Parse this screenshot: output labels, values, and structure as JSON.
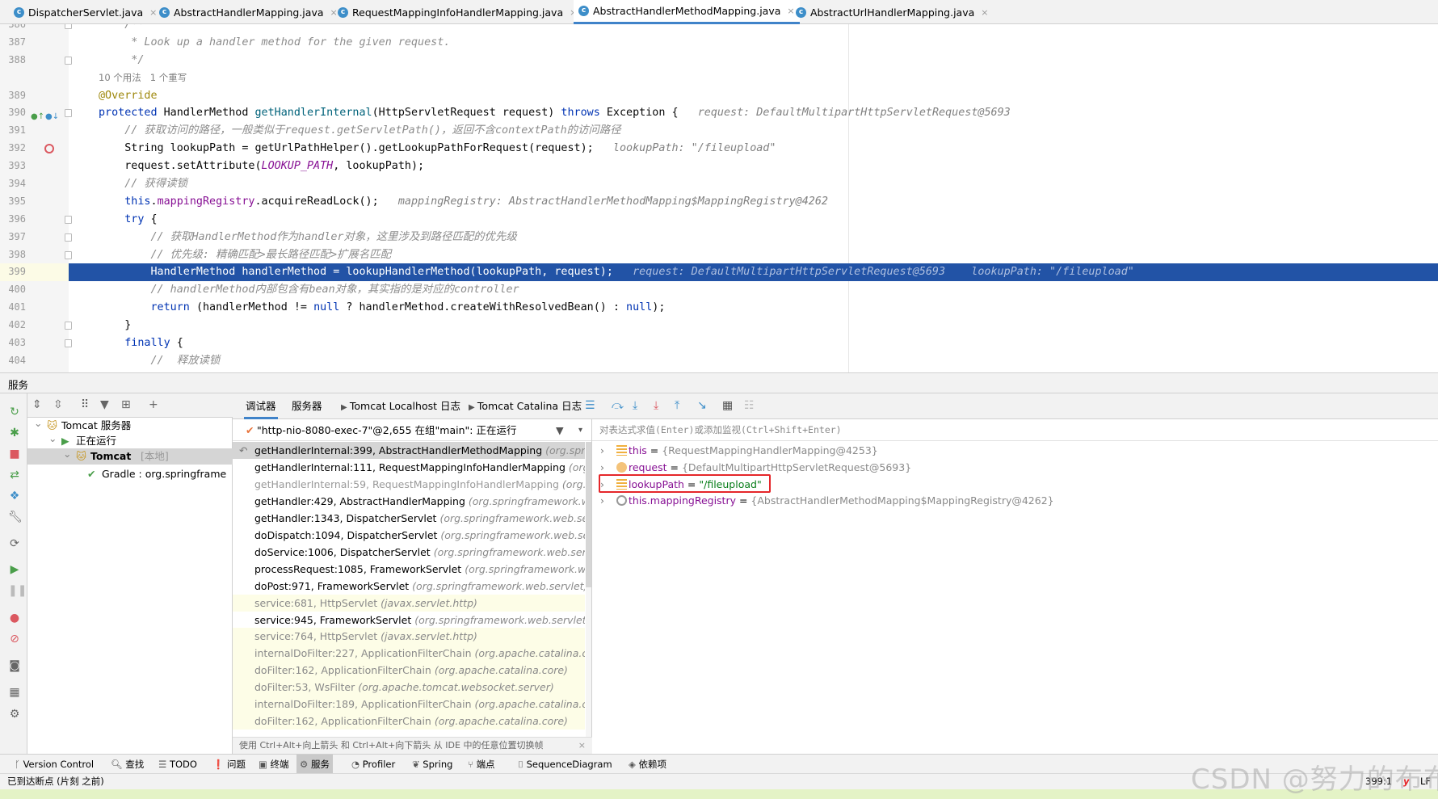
{
  "tabs": [
    {
      "label": "DispatcherServlet.java",
      "active": false
    },
    {
      "label": "AbstractHandlerMapping.java",
      "active": false
    },
    {
      "label": "RequestMappingInfoHandlerMapping.java",
      "active": false
    },
    {
      "label": "AbstractHandlerMethodMapping.java",
      "active": true
    },
    {
      "label": "AbstractUrlHandlerMapping.java",
      "active": false
    }
  ],
  "editor": {
    "current_line": 399,
    "lines": [
      {
        "n": "386",
        "fold": true,
        "tokens": [
          {
            "t": "    /**",
            "c": "cm"
          }
        ]
      },
      {
        "n": "387",
        "tokens": [
          {
            "t": "     * Look up a handler method for the given request.",
            "c": "cm"
          }
        ]
      },
      {
        "n": "388",
        "fold": true,
        "tokens": [
          {
            "t": "     */",
            "c": "cm"
          }
        ]
      },
      {
        "n": "",
        "inlay": "10 个用法   1 个重写"
      },
      {
        "n": "389",
        "tokens": [
          {
            "t": "@Override",
            "c": "ann"
          }
        ]
      },
      {
        "n": "390",
        "fold": true,
        "markers": true,
        "tokens": [
          {
            "t": "protected ",
            "c": "kw"
          },
          {
            "t": "HandlerMethod ",
            "c": "tx"
          },
          {
            "t": "getHandlerInternal",
            "c": "fn"
          },
          {
            "t": "(HttpServletRequest request) ",
            "c": "tx"
          },
          {
            "t": "throws ",
            "c": "kw"
          },
          {
            "t": "Exception {  ",
            "c": "tx"
          },
          {
            "t": " request: DefaultMultipartHttpServletRequest@5693",
            "c": "hint"
          }
        ]
      },
      {
        "n": "391",
        "tokens": [
          {
            "t": "    // 获取访问的路径，一般类似于request.getServletPath()，返回不含contextPath的访问路径",
            "c": "cm"
          }
        ]
      },
      {
        "n": "392",
        "breakpoint": true,
        "tokens": [
          {
            "t": "    String lookupPath = getUrlPathHelper().getLookupPathForRequest(request);  ",
            "c": "tx"
          },
          {
            "t": " lookupPath: \"/fileupload\"",
            "c": "hint"
          }
        ]
      },
      {
        "n": "393",
        "tokens": [
          {
            "t": "    request.setAttribute(",
            "c": "tx"
          },
          {
            "t": "LOOKUP_PATH",
            "c": "cst"
          },
          {
            "t": ", lookupPath);",
            "c": "tx"
          }
        ]
      },
      {
        "n": "394",
        "tokens": [
          {
            "t": "    // 获得读锁",
            "c": "cm"
          }
        ]
      },
      {
        "n": "395",
        "tokens": [
          {
            "t": "    this",
            "c": "kw"
          },
          {
            "t": ".",
            "c": "tx"
          },
          {
            "t": "mappingRegistry",
            "c": "fld"
          },
          {
            "t": ".acquireReadLock();  ",
            "c": "tx"
          },
          {
            "t": " mappingRegistry: AbstractHandlerMethodMapping$MappingRegistry@4262",
            "c": "hint"
          }
        ]
      },
      {
        "n": "396",
        "fold": true,
        "tokens": [
          {
            "t": "    try",
            "c": "kw"
          },
          {
            "t": " {",
            "c": "tx"
          }
        ]
      },
      {
        "n": "397",
        "fold": true,
        "tokens": [
          {
            "t": "        // 获取HandlerMethod作为handler对象，这里涉及到路径匹配的优先级",
            "c": "cm"
          }
        ]
      },
      {
        "n": "398",
        "fold": true,
        "tokens": [
          {
            "t": "        // 优先级: 精确匹配>最长路径匹配>扩展名匹配",
            "c": "cm"
          }
        ]
      },
      {
        "n": "399",
        "highlight": true,
        "tokens": [
          {
            "t": "        HandlerMethod handlerMethod = lookupHandlerMethod(lookupPath, request);  ",
            "c": "tx"
          },
          {
            "t": " request: DefaultMultipartHttpServletRequest@5693    lookupPath: \"/fileupload\"",
            "c": "hint"
          }
        ]
      },
      {
        "n": "400",
        "tokens": [
          {
            "t": "        // handlerMethod内部包含有bean对象，其实指的是对应的controller",
            "c": "cm"
          }
        ]
      },
      {
        "n": "401",
        "tokens": [
          {
            "t": "        return ",
            "c": "kw"
          },
          {
            "t": "(handlerMethod != ",
            "c": "tx"
          },
          {
            "t": "null",
            "c": "kw"
          },
          {
            "t": " ? handlerMethod.createWithResolvedBean() : ",
            "c": "tx"
          },
          {
            "t": "null",
            "c": "kw"
          },
          {
            "t": ");",
            "c": "tx"
          }
        ]
      },
      {
        "n": "402",
        "fold": true,
        "tokens": [
          {
            "t": "    }",
            "c": "tx"
          }
        ]
      },
      {
        "n": "403",
        "fold": true,
        "tokens": [
          {
            "t": "    finally",
            "c": "kw"
          },
          {
            "t": " {",
            "c": "tx"
          }
        ]
      },
      {
        "n": "404",
        "tokens": [
          {
            "t": "        //  释放读锁",
            "c": "cm"
          }
        ]
      }
    ]
  },
  "services": {
    "title": "服务",
    "tree": [
      {
        "label": "Tomcat 服务器",
        "level": 0,
        "icon": "tomcat-icon"
      },
      {
        "label": "正在运行",
        "level": 1,
        "icon": "run-icon"
      },
      {
        "label": "Tomcat",
        "suffix": "[本地]",
        "level": 2,
        "icon": "tomcat-icon",
        "selected": true
      },
      {
        "label": "Gradle : org.springframe",
        "level": 3,
        "icon": "gradle-icon"
      }
    ]
  },
  "debugger": {
    "tabs": [
      {
        "label": "调试器",
        "active": true
      },
      {
        "label": "服务器"
      },
      {
        "label": "Tomcat Localhost 日志"
      },
      {
        "label": "Tomcat Catalina 日志"
      }
    ],
    "thread": "\"http-nio-8080-exec-7\"@2,655 在组\"main\": 正在运行",
    "frames": [
      {
        "m": "getHandlerInternal:399, AbstractHandlerMethodMapping",
        "p": "(org.springframework.web.servlet.handler)",
        "style": "sel"
      },
      {
        "m": "getHandlerInternal:111, RequestMappingInfoHandlerMapping",
        "p": "(org.springframework.web.servlet.mvc.method)",
        "style": ""
      },
      {
        "m": "getHandlerInternal:59, RequestMappingInfoHandlerMapping",
        "p": "(org.springframework.web.servlet.mvc.method)",
        "style": "dim"
      },
      {
        "m": "getHandler:429, AbstractHandlerMapping",
        "p": "(org.springframework.web.servlet.handler)",
        "style": ""
      },
      {
        "m": "getHandler:1343, DispatcherServlet",
        "p": "(org.springframework.web.servlet)",
        "style": ""
      },
      {
        "m": "doDispatch:1094, DispatcherServlet",
        "p": "(org.springframework.web.servlet)",
        "style": ""
      },
      {
        "m": "doService:1006, DispatcherServlet",
        "p": "(org.springframework.web.servlet)",
        "style": ""
      },
      {
        "m": "processRequest:1085, FrameworkServlet",
        "p": "(org.springframework.web.servlet)",
        "style": ""
      },
      {
        "m": "doPost:971, FrameworkServlet",
        "p": "(org.springframework.web.servlet)",
        "style": ""
      },
      {
        "m": "service:681, HttpServlet",
        "p": "(javax.servlet.http)",
        "style": "lib"
      },
      {
        "m": "service:945, FrameworkServlet",
        "p": "(org.springframework.web.servlet)",
        "style": ""
      },
      {
        "m": "service:764, HttpServlet",
        "p": "(javax.servlet.http)",
        "style": "lib"
      },
      {
        "m": "internalDoFilter:227, ApplicationFilterChain",
        "p": "(org.apache.catalina.core)",
        "style": "lib"
      },
      {
        "m": "doFilter:162, ApplicationFilterChain",
        "p": "(org.apache.catalina.core)",
        "style": "lib"
      },
      {
        "m": "doFilter:53, WsFilter",
        "p": "(org.apache.tomcat.websocket.server)",
        "style": "lib"
      },
      {
        "m": "internalDoFilter:189, ApplicationFilterChain",
        "p": "(org.apache.catalina.core)",
        "style": "lib"
      },
      {
        "m": "doFilter:162, ApplicationFilterChain",
        "p": "(org.apache.catalina.core)",
        "style": "lib"
      }
    ],
    "help": "使用 Ctrl+Alt+向上箭头 和 Ctrl+Alt+向下箭头 从 IDE 中的任意位置切换帧",
    "eval_placeholder": "对表达式求值(Enter)或添加监视(Ctrl+Shift+Enter)",
    "variables": [
      {
        "name": "this",
        "eq": " = ",
        "value": "{RequestMappingHandlerMapping@4253}",
        "icon": "field-icon"
      },
      {
        "name": "request",
        "eq": " = ",
        "value": "{DefaultMultipartHttpServletRequest@5693}",
        "icon": "parameter-icon"
      },
      {
        "name": "lookupPath",
        "eq": " = ",
        "value": "\"/fileupload\"",
        "icon": "field-icon",
        "string": true,
        "boxed": true
      },
      {
        "name": "this.mappingRegistry",
        "eq": " = ",
        "value": "{AbstractHandlerMethodMapping$MappingRegistry@4262}",
        "icon": "watch-icon"
      }
    ]
  },
  "bottom_toolbar": [
    {
      "label": "Version Control",
      "icon": "vcs-icon"
    },
    {
      "label": "查找",
      "icon": "search-icon"
    },
    {
      "label": "TODO",
      "icon": "todo-icon"
    },
    {
      "label": "问题",
      "icon": "problems-icon"
    },
    {
      "label": "终端",
      "icon": "terminal-icon"
    },
    {
      "label": "服务",
      "icon": "services-icon",
      "selected": true
    },
    {
      "label": "Profiler",
      "icon": "profiler-icon"
    },
    {
      "label": "Spring",
      "icon": "spring-icon"
    },
    {
      "label": "端点",
      "icon": "endpoints-icon"
    },
    {
      "label": "SequenceDiagram",
      "icon": "sequence-icon"
    },
    {
      "label": "依赖项",
      "icon": "dependencies-icon"
    }
  ],
  "status": {
    "message": "已到达断点 (片刻 之前)",
    "position": "399:1",
    "line_ending": "LF"
  },
  "watermark": "CSDN @努力的布布",
  "colors": {
    "accent": "#4083c9",
    "highlight_line": "#2253a6",
    "breakpoint": "#db5860",
    "annotation_box": "#e5262a"
  }
}
